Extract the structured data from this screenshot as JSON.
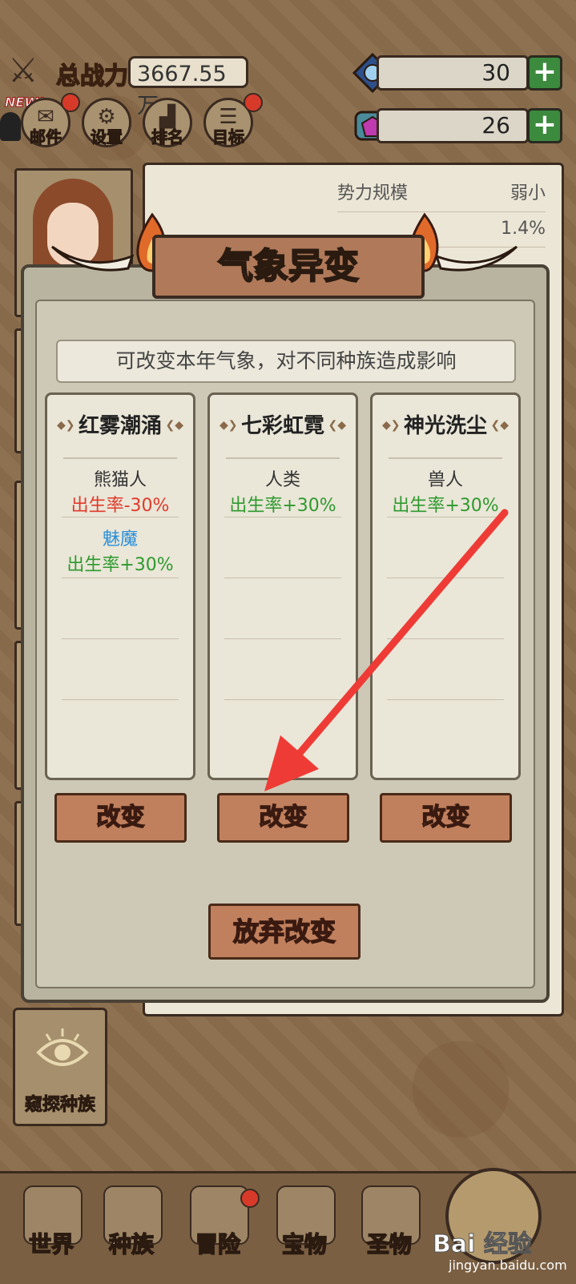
{
  "top": {
    "power_label": "总战力",
    "power_value": "3667.55万",
    "resource1_value": "30",
    "resource2_value": "26",
    "plus": "+",
    "new_badge": "NEW!"
  },
  "top_buttons": [
    {
      "label": "邮件"
    },
    {
      "label": "设置"
    },
    {
      "label": "排名"
    },
    {
      "label": "目标"
    }
  ],
  "info_panel": {
    "row1_label": "势力规模",
    "row1_value": "弱小",
    "row2_value": "1.4%"
  },
  "modal": {
    "title": "气象异变",
    "subtitle": "可改变本年气象，对不同种族造成影响",
    "cards": [
      {
        "title": "红雾潮涌",
        "effects": [
          {
            "race": "熊猫人",
            "effect": "出生率-30%"
          },
          {
            "race": "魅魔",
            "effect": "出生率+30%"
          }
        ],
        "button": "改变"
      },
      {
        "title": "七彩虹霓",
        "effects": [
          {
            "race": "人类",
            "effect": "出生率+30%"
          }
        ],
        "button": "改变"
      },
      {
        "title": "神光洗尘",
        "effects": [
          {
            "race": "兽人",
            "effect": "出生率+30%"
          }
        ],
        "button": "改变"
      }
    ],
    "abandon_button": "放弃改变"
  },
  "peek_button": "窥探种族",
  "nav": [
    {
      "label": "世界"
    },
    {
      "label": "种族"
    },
    {
      "label": "冒险"
    },
    {
      "label": "宝物"
    },
    {
      "label": "圣物"
    }
  ],
  "watermark": "Bai 经验",
  "watermark_url": "jingyan.baidu.com",
  "colors": {
    "negative": "#e03a2a",
    "positive": "#2e9a2e",
    "race_highlight": "#2a8fd8",
    "arrow": "#ef3b36"
  }
}
